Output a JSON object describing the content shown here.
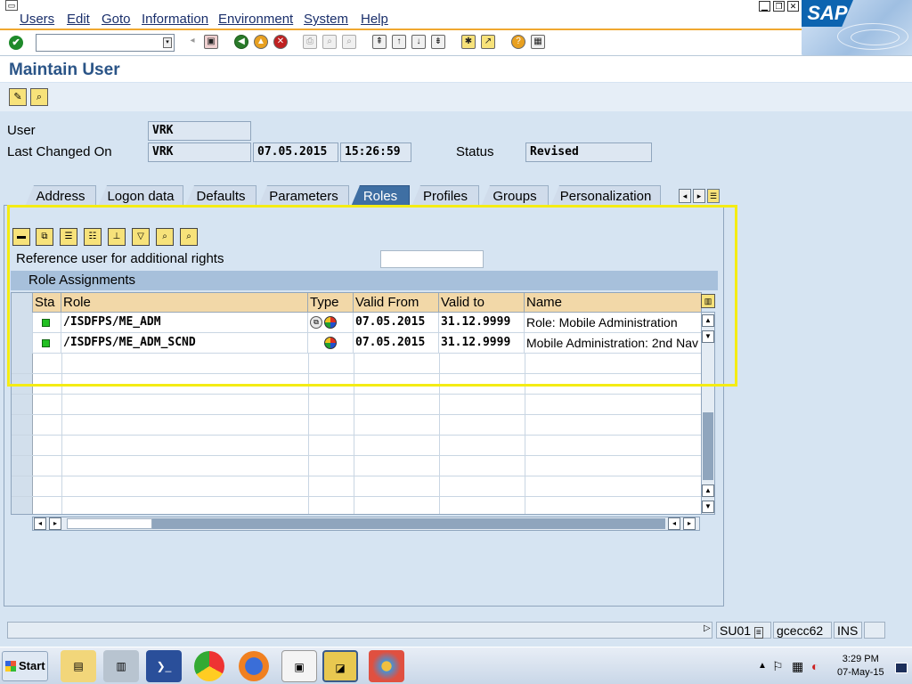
{
  "menu": {
    "items": [
      "Users",
      "Edit",
      "Goto",
      "Information",
      "Environment",
      "System",
      "Help"
    ]
  },
  "window_controls": {
    "minimize": "▁",
    "restore": "❐",
    "close": "✕"
  },
  "logo": {
    "text": "SAP"
  },
  "page_title": "Maintain User",
  "header": {
    "user_label": "User",
    "user_value": "VRK",
    "last_changed_label": "Last Changed On",
    "last_changed_by": "VRK",
    "last_changed_date": "07.05.2015",
    "last_changed_time": "15:26:59",
    "status_label": "Status",
    "status_value": "Revised"
  },
  "tabs": [
    {
      "label": "Address",
      "active": false
    },
    {
      "label": "Logon data",
      "active": false
    },
    {
      "label": "Defaults",
      "active": false
    },
    {
      "label": "Parameters",
      "active": false
    },
    {
      "label": "Roles",
      "active": true
    },
    {
      "label": "Profiles",
      "active": false
    },
    {
      "label": "Groups",
      "active": false
    },
    {
      "label": "Personalization",
      "active": false
    }
  ],
  "roles_tab": {
    "reference_user_label": "Reference user for additional rights",
    "reference_user_value": "",
    "table_title": "Role Assignments",
    "columns": [
      "Sta",
      "Role",
      "Type",
      "Valid From",
      "Valid to",
      "Name"
    ],
    "rows": [
      {
        "role": "/ISDFPS/ME_ADM",
        "valid_from": "07.05.2015",
        "valid_to": "31.12.9999",
        "name": "Role: Mobile Administration",
        "composite": true
      },
      {
        "role": "/ISDFPS/ME_ADM_SCND",
        "valid_from": "07.05.2015",
        "valid_to": "31.12.9999",
        "name": "Mobile Administration: 2nd Nav",
        "composite": false
      }
    ]
  },
  "statusbar": {
    "transaction": "SU01",
    "server": "gcecc62",
    "mode": "INS"
  },
  "taskbar": {
    "start_label": "Start",
    "time": "3:29 PM",
    "date": "07-May-15"
  },
  "colors": {
    "title": "#2a5487",
    "active_tab": "#3f6fa3",
    "column_header": "#f2d8a8",
    "highlight": "#f4ec14",
    "status_green": "#22c022"
  },
  "icons": [
    "check-icon",
    "save-icon",
    "back-icon",
    "exit-icon",
    "cancel-icon",
    "print-icon",
    "find-icon",
    "help-icon",
    "display-change-icon"
  ]
}
